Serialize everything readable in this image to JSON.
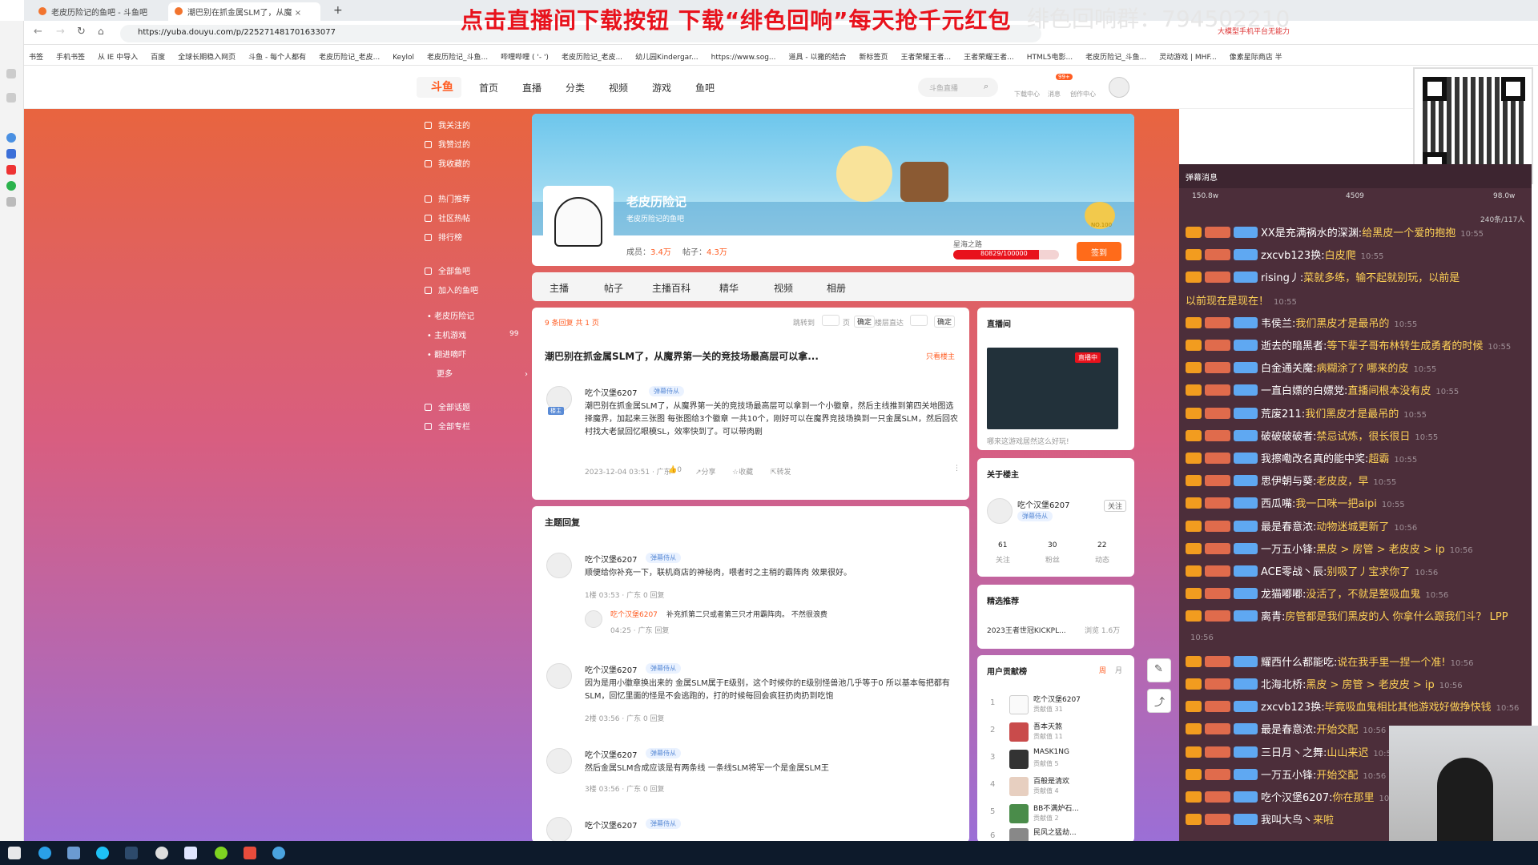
{
  "browser": {
    "tabs": [
      {
        "label": "老皮历险记的鱼吧 - 斗鱼吧"
      },
      {
        "label": "潮巴别在抓金属SLM了，从魔"
      }
    ],
    "url": "https://yuba.douyu.com/p/225271481701633077",
    "bookmarks": [
      "书签",
      "手机书签",
      "从 IE 中导入",
      "百度",
      "全球长期稳入网页",
      "斗鱼 - 每个人都有",
      "老皮历险记_老皮...",
      "Keylol",
      "老皮历险记_斗鱼...",
      "哔哩哔哩 ( '- ')",
      "老皮历险记_老皮...",
      "幼儿园Kindergar...",
      "https://www.sog...",
      "道具 - 以撒的结合",
      "新标签页",
      "王者荣耀王者...",
      "王者荣耀王者...",
      "HTML5电影...",
      "老皮历险记_斗鱼...",
      "灵动游戏 | MHF...",
      "像素星际商店 半"
    ],
    "ext_label": "大模型手机平台无能力"
  },
  "overlay": {
    "promo": "点击直播间下载按钮 下载“绯色回响”每天抢千元红包",
    "group": "绯色回响群：794502210"
  },
  "site": {
    "logo": "斗鱼",
    "nav": [
      "首页",
      "直播",
      "分类",
      "视频",
      "游戏",
      "鱼吧"
    ],
    "search_placeholder": "斗鱼直播",
    "header_icons": [
      "下载中心",
      "消息",
      "创作中心"
    ],
    "msg_badge": "99+"
  },
  "sidebar": {
    "items": [
      {
        "label": "我关注的"
      },
      {
        "label": "我赞过的"
      },
      {
        "label": "我收藏的"
      },
      {
        "label": "热门推荐"
      },
      {
        "label": "社区热帖"
      },
      {
        "label": "排行榜"
      },
      {
        "label": "全部鱼吧"
      },
      {
        "label": "加入的鱼吧"
      }
    ],
    "sub": [
      {
        "label": "老皮历险记"
      },
      {
        "label": "主机游戏",
        "count": "99"
      },
      {
        "label": "翻进嘀吓"
      },
      {
        "label": "更多"
      }
    ],
    "bottom": [
      {
        "label": "全部话题"
      },
      {
        "label": "全部专栏"
      }
    ]
  },
  "group": {
    "name": "老皮历险记",
    "subtitle": "老皮历险记的鱼吧",
    "members_label": "成员：",
    "members": "3.4万",
    "posts_label": "帖子：",
    "posts": "4.3万",
    "level_name": "星海之路",
    "level_progress": "80829/100000",
    "level_fraction": 0.81,
    "rank_badge": "NO.100",
    "checkin": "签到"
  },
  "tabs": [
    "主播",
    "帖子",
    "主播百科",
    "精华",
    "视频",
    "相册"
  ],
  "post": {
    "reply_count": "9 条回复 共 1 页",
    "jump_label": "跳转到",
    "page_suffix": "页",
    "confirm": "确定",
    "floor_label": "楼层直达",
    "confirm2": "确定",
    "title": "潮巴别在抓金属SLM了，从魔界第一关的竞技场最高层可以拿...",
    "only_op": "只看楼主",
    "author": "吃个汉堡6207",
    "author_badge": "弹幕侍从",
    "op_tag": "楼主",
    "body": "潮巴别在抓金属SLM了，从魔界第一关的竞技场最高层可以拿到一个小徽章，然后主线推到第四关地图选择魔界，加起来三张图 每张图给3个徽章 一共10个，刚好可以在魔界竞技场换到一只金属SLM，然后回农村找大老鼠回忆眼模SL，效率快到了。可以带肉剧",
    "date": "2023-12-04 03:51 · 广东",
    "likes": "0",
    "share": "分享",
    "fav": "收藏",
    "forward": "转发"
  },
  "replies": {
    "title": "主题回复",
    "items": [
      {
        "author": "吃个汉堡6207",
        "badge": "弹幕侍从",
        "text": "顺便给你补充一下，联机商店的神秘肉，喂者时之主稍的霸阵肉 效果很好。",
        "meta": "1楼  03:53 · 广东  0  回复",
        "sub_author": "吃个汉堡6207",
        "sub_text": "补充抓第二只或者第三只才用霸阵肉。 不然很浪费",
        "sub_meta": "04:25 · 广东  回复"
      },
      {
        "author": "吃个汉堡6207",
        "badge": "弹幕侍从",
        "text": "因为是用小徽章换出来的 金属SLM属于E级别，这个时候你的E级别怪兽池几乎等于0 所以基本每把都有SLM，回忆里面的怪是不会逃跑的，打的时候每回会疯狂扔肉扔到吃饱",
        "meta": "2楼  03:56 · 广东  0  回复"
      },
      {
        "author": "吃个汉堡6207",
        "badge": "弹幕侍从",
        "text": "然后金属SLM合成应该是有两条线 一条线SLM将军一个是金属SLM王",
        "meta": "3楼  03:56 · 广东  0  回复"
      },
      {
        "author": "吃个汉堡6207",
        "badge": "弹幕侍从",
        "text": "",
        "meta": ""
      }
    ]
  },
  "widgets": {
    "live_title": "直播间",
    "live_badge": "直播中",
    "live_caption": "哪来这游戏居然这么好玩!",
    "about_title": "关于楼主",
    "about_name": "吃个汉堡6207",
    "about_badge": "弹幕侍从",
    "about_follow": "关注",
    "about_stats": [
      {
        "num": "61",
        "label": "关注"
      },
      {
        "num": "30",
        "label": "粉丝"
      },
      {
        "num": "22",
        "label": "动态"
      }
    ],
    "sel_title": "精选推荐",
    "sel_item": "2023王者世冠KICKPL...",
    "sel_views": "浏览 1.6万",
    "rank_title": "用户贡献榜",
    "rank_tabs": [
      "周",
      "月"
    ],
    "rank": [
      {
        "n": "1",
        "name": "吃个汉堡6207",
        "score": "贡献值 31"
      },
      {
        "n": "2",
        "name": "吾本天煞",
        "score": "贡献值 11"
      },
      {
        "n": "3",
        "name": "MASK1NG",
        "score": "贡献值 5"
      },
      {
        "n": "4",
        "name": "百般是清欢",
        "score": "贡献值 4"
      },
      {
        "n": "5",
        "name": "BB不满炉石...",
        "score": "贡献值 2"
      },
      {
        "n": "6",
        "name": "民风之猛劫...",
        "score": ""
      }
    ]
  },
  "danmaku": {
    "header": "弹幕消息",
    "stats": [
      "150.8w",
      "4509",
      "98.0w"
    ],
    "online": "240条/117人",
    "lines": [
      {
        "name": "XX是充满祸水的深渊:",
        "msg": "给黑皮一个爱的抱抱",
        "t": "10:55"
      },
      {
        "name": "zxcvb123换:",
        "msg": "白皮爬",
        "t": "10:55"
      },
      {
        "name": "rising丿:",
        "msg": "菜就多练，输不起就别玩，以前是",
        "t": ""
      },
      {
        "name": "",
        "msg": "以前现在是现在！",
        "t": "10:55"
      },
      {
        "name": "韦侯兰:",
        "msg": "我们黑皮才是最吊的",
        "t": "10:55"
      },
      {
        "name": "逝去的暗黑者:",
        "msg": "等下辈子哥布林转生成勇者的时候",
        "t": "10:55"
      },
      {
        "name": "白金通关魔:",
        "msg": "病糊涂了? 哪来的皮",
        "t": "10:55"
      },
      {
        "name": "一直白嫖的白嫖党:",
        "msg": "直播间根本没有皮",
        "t": "10:55"
      },
      {
        "name": "荒废211:",
        "msg": "我们黑皮才是最吊的",
        "t": "10:55"
      },
      {
        "name": "破破破破者:",
        "msg": "禁忌试炼，很长很日",
        "t": "10:55"
      },
      {
        "name": "我擦嘞改名真的能中奖:",
        "msg": "超霸",
        "t": "10:55"
      },
      {
        "name": "思伊朝与葵:",
        "msg": "老皮皮，早",
        "t": "10:55"
      },
      {
        "name": "西瓜嘴:",
        "msg": "我一口咪一把aipi",
        "t": "10:55"
      },
      {
        "name": "最是春意浓:",
        "msg": "动物迷城更新了",
        "t": "10:56"
      },
      {
        "name": "一万五小锋:",
        "msg": "黑皮 > 房管 > 老皮皮 > ip",
        "t": "10:56"
      },
      {
        "name": "ACE零战丶辰:",
        "msg": "别吸了丿宝求你了",
        "t": "10:56"
      },
      {
        "name": "龙猫嘟嘟:",
        "msg": "没活了，不就是整吸血鬼",
        "t": "10:56"
      },
      {
        "name": "离青:",
        "msg": "房管都是我们黑皮的人 你拿什么跟我们斗？ LPP",
        "t": ""
      },
      {
        "name": "",
        "msg": "",
        "t": "10:56"
      },
      {
        "name": "耀西什么都能吃:",
        "msg": "说在我手里一捏一个准!",
        "t": "10:56"
      },
      {
        "name": "北海北桥:",
        "msg": "黑皮 > 房管 > 老皮皮 > ip",
        "t": "10:56"
      },
      {
        "name": "zxcvb123换:",
        "msg": "毕竟吸血鬼相比其他游戏好做挣快钱",
        "t": "10:56"
      },
      {
        "name": "最是春意浓:",
        "msg": "开始交配",
        "t": "10:56"
      },
      {
        "name": "三日月丶之舞:",
        "msg": "山山来迟",
        "t": "10:56"
      },
      {
        "name": "一万五小锋:",
        "msg": "开始交配",
        "t": "10:56"
      },
      {
        "name": "吃个汉堡6207:",
        "msg": "你在那里",
        "t": "10:56"
      },
      {
        "name": "我叫大鸟丶",
        "msg": "来啦",
        "t": ""
      }
    ]
  },
  "colors": {
    "brand": "#ff5d23",
    "promo_red": "#e8121c",
    "danmaku_bg": "#4c2e3a",
    "gradient_top": "#e8643f",
    "gradient_bottom": "#9b6fd6"
  }
}
